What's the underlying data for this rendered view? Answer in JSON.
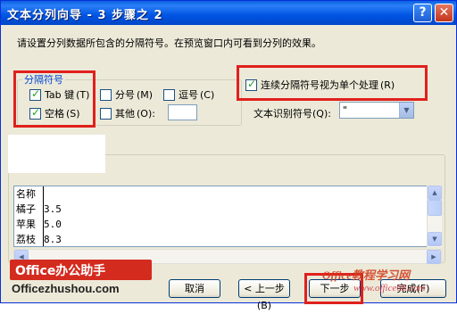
{
  "window": {
    "title": "文本分列向导 - 3 步骤之 2",
    "help_glyph": "?",
    "close_glyph": "✕"
  },
  "instruction": "请设置分列数据所包含的分隔符号。在预览窗口内可看到分列的效果。",
  "delimiters": {
    "group_label": "分隔符号",
    "tab": {
      "label": "Tab 键",
      "shortcut": "(T)",
      "checked": true
    },
    "semicolon": {
      "label": "分号",
      "shortcut": "(M)",
      "checked": false
    },
    "comma": {
      "label": "逗号",
      "shortcut": "(C)",
      "checked": false
    },
    "space": {
      "label": "空格",
      "shortcut": "(S)",
      "checked": true
    },
    "other": {
      "label": "其他",
      "shortcut": "(O):",
      "checked": false,
      "value": ""
    }
  },
  "consecutive": {
    "label": "连续分隔符号视为单个处理",
    "shortcut": "(R)",
    "checked": true
  },
  "text_qualifier": {
    "label": "文本识别符号",
    "shortcut": "(Q):",
    "value": "\""
  },
  "preview": {
    "rows": [
      [
        "名称",
        ""
      ],
      [
        "橘子",
        "3.5"
      ],
      [
        "苹果",
        "5.0"
      ],
      [
        "荔枝",
        "8.3"
      ]
    ]
  },
  "buttons": {
    "cancel": "取消",
    "back": "< 上一步(B)",
    "next": "下一步",
    "finish": "完成(F)"
  },
  "logo": {
    "badge": "Office办公助手",
    "site": "Officezhushou.com"
  },
  "watermark": {
    "main": "Office教程学习网",
    "sub": "www.office68.com"
  },
  "colors": {
    "highlight_border": "#e0201d",
    "title_bar": "#0054e3"
  }
}
